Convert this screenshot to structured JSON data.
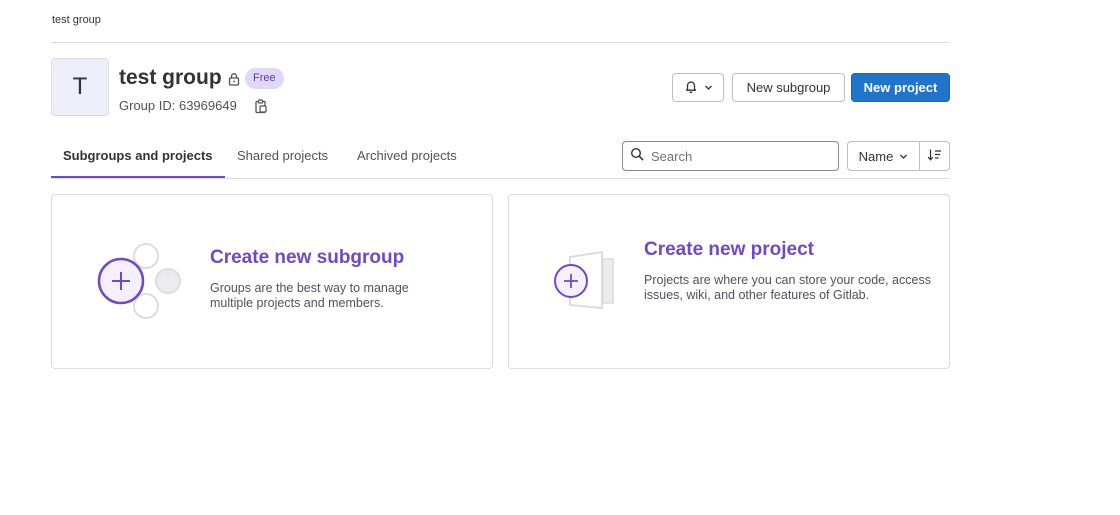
{
  "breadcrumb": {
    "label": "test group"
  },
  "group": {
    "avatar_letter": "T",
    "name": "test group",
    "badge": "Free",
    "group_id": "Group ID: 63969649"
  },
  "actions": {
    "new_subgroup": "New subgroup",
    "new_project": "New project"
  },
  "tabs": [
    {
      "label": "Subgroups and projects",
      "active": true
    },
    {
      "label": "Shared projects",
      "active": false
    },
    {
      "label": "Archived projects",
      "active": false
    }
  ],
  "search": {
    "placeholder": "Search"
  },
  "sort": {
    "selected": "Name"
  },
  "cards": [
    {
      "title": "Create new subgroup",
      "description": "Groups are the best way to manage multiple projects and members."
    },
    {
      "title": "Create new project",
      "description": "Projects are where you can store your code, access issues, wiki, and other features of Gitlab."
    }
  ],
  "colors": {
    "accent": "#6e49cb",
    "primary": "#1f75cb",
    "badge_bg": "#e1d8f9"
  }
}
